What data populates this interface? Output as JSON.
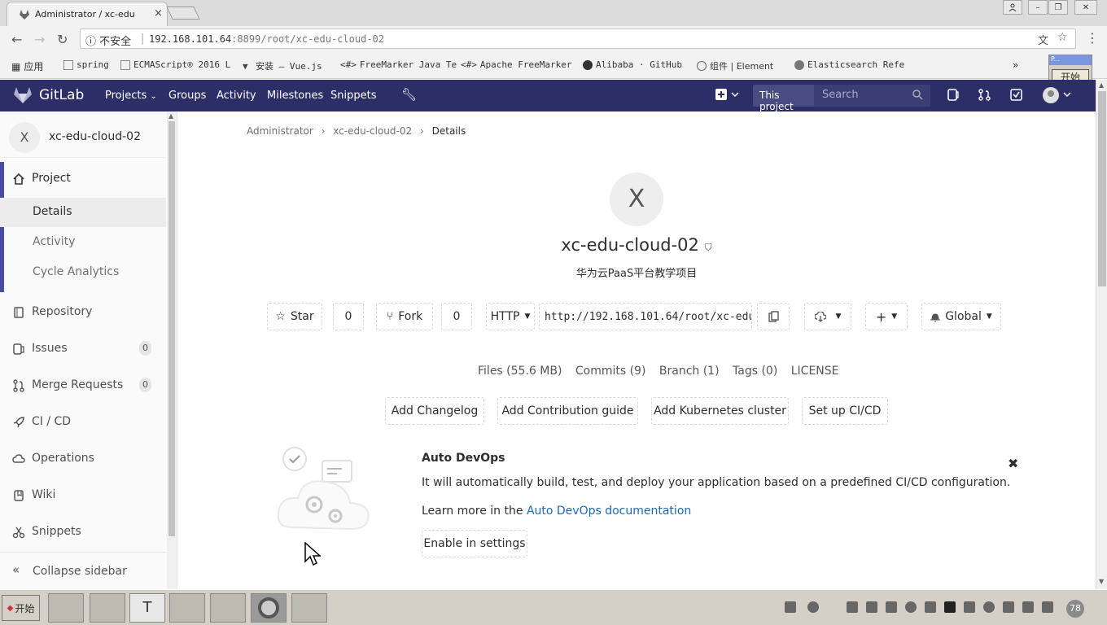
{
  "browser": {
    "tab_title": "Administrator / xc-edu",
    "insecure_label": "不安全",
    "url_host": "192.168.101.64",
    "url_rest": ":8899/root/xc-edu-cloud-02",
    "bookmarks": [
      "应用",
      "spring",
      "ECMAScript® 2016 L",
      "安装 — Vue.js",
      "FreeMarker Java Te",
      "Apache FreeMarker",
      "Alibaba · GitHub",
      "组件 | Element",
      "Elasticsearch Refe"
    ],
    "popup_title": "P...",
    "popup_button": "开始"
  },
  "gitlab_nav": {
    "brand": "GitLab",
    "projects": "Projects",
    "groups": "Groups",
    "activity": "Activity",
    "milestones": "Milestones",
    "snippets": "Snippets",
    "scope": "This project",
    "search_placeholder": "Search"
  },
  "sidebar": {
    "avatar_letter": "X",
    "project_name": "xc-edu-cloud-02",
    "project": "Project",
    "details": "Details",
    "activity": "Activity",
    "cycle_analytics": "Cycle Analytics",
    "repository": "Repository",
    "issues": "Issues",
    "issues_count": "0",
    "merge_requests": "Merge Requests",
    "merge_requests_count": "0",
    "cicd": "CI / CD",
    "operations": "Operations",
    "wiki": "Wiki",
    "snippets": "Snippets",
    "collapse": "Collapse sidebar"
  },
  "breadcrumb": {
    "admin": "Administrator",
    "project": "xc-edu-cloud-02",
    "current": "Details"
  },
  "project": {
    "avatar_letter": "X",
    "title": "xc-edu-cloud-02",
    "description": "华为云PaaS平台教学项目",
    "star_label": "Star",
    "star_count": "0",
    "fork_label": "Fork",
    "fork_count": "0",
    "protocol": "HTTP",
    "clone_url": "http://192.168.101.64/root/xc-edu",
    "notification": "Global"
  },
  "stats": {
    "files": "Files (55.6 MB)",
    "commits": "Commits (9)",
    "branch": "Branch (1)",
    "tags": "Tags (0)",
    "license": "LICENSE"
  },
  "actions": {
    "changelog": "Add Changelog",
    "contribution": "Add Contribution guide",
    "kubernetes": "Add Kubernetes cluster",
    "cicd": "Set up CI/CD"
  },
  "devops": {
    "title": "Auto DevOps",
    "description": "It will automatically build, test, and deploy your application based on a predefined CI/CD configuration.",
    "learn_prefix": "Learn more in the ",
    "learn_link": "Auto DevOps documentation",
    "enable": "Enable in settings"
  },
  "taskbar": {
    "start": "开始",
    "clock": "78"
  },
  "colors": {
    "nav_bg": "#2d2d68",
    "link": "#1b69b6"
  }
}
